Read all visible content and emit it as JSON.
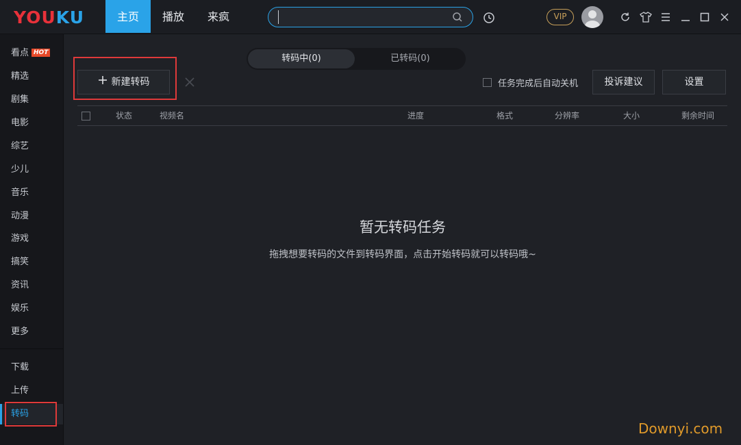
{
  "app": {
    "logo_text": "YOUKU",
    "nav_tabs": [
      {
        "label": "主页",
        "active": true
      },
      {
        "label": "播放",
        "active": false
      },
      {
        "label": "来疯",
        "active": false
      }
    ],
    "search": {
      "value": "",
      "placeholder": ""
    },
    "vip_label": "VIP",
    "icons": [
      "search-icon",
      "history-clock-icon",
      "refresh-icon",
      "skin-tshirt-icon",
      "menu-icon",
      "minimize-icon",
      "maximize-icon",
      "close-icon"
    ]
  },
  "sidebar": {
    "items": [
      {
        "label": "看点",
        "badge": "HOT"
      },
      {
        "label": "精选"
      },
      {
        "label": "剧集"
      },
      {
        "label": "电影"
      },
      {
        "label": "综艺"
      },
      {
        "label": "少儿"
      },
      {
        "label": "音乐"
      },
      {
        "label": "动漫"
      },
      {
        "label": "游戏"
      },
      {
        "label": "搞笑"
      },
      {
        "label": "资讯"
      },
      {
        "label": "娱乐"
      },
      {
        "label": "更多"
      }
    ],
    "bottom_items": [
      {
        "label": "下载"
      },
      {
        "label": "上传"
      },
      {
        "label": "转码",
        "active": true
      }
    ]
  },
  "main": {
    "segments": [
      {
        "label": "转码中(0)",
        "active": true
      },
      {
        "label": "已转码(0)",
        "active": false
      }
    ],
    "new_button_label": "新建转码",
    "auto_shutdown_label": "任务完成后自动关机",
    "feedback_button_label": "投诉建议",
    "settings_button_label": "设置",
    "columns": [
      "状态",
      "视频名",
      "进度",
      "格式",
      "分辨率",
      "大小",
      "剩余时间"
    ],
    "empty_title": "暂无转码任务",
    "empty_subtitle": "拖拽想要转码的文件到转码界面，点击开始转码就可以转码哦~"
  },
  "colors": {
    "accent": "#2aa3e8",
    "highlight_box": "#e03a3a",
    "vip_gold": "#c9a15a",
    "hot_badge": "#e84a2a"
  },
  "watermark": "Downyi.com"
}
